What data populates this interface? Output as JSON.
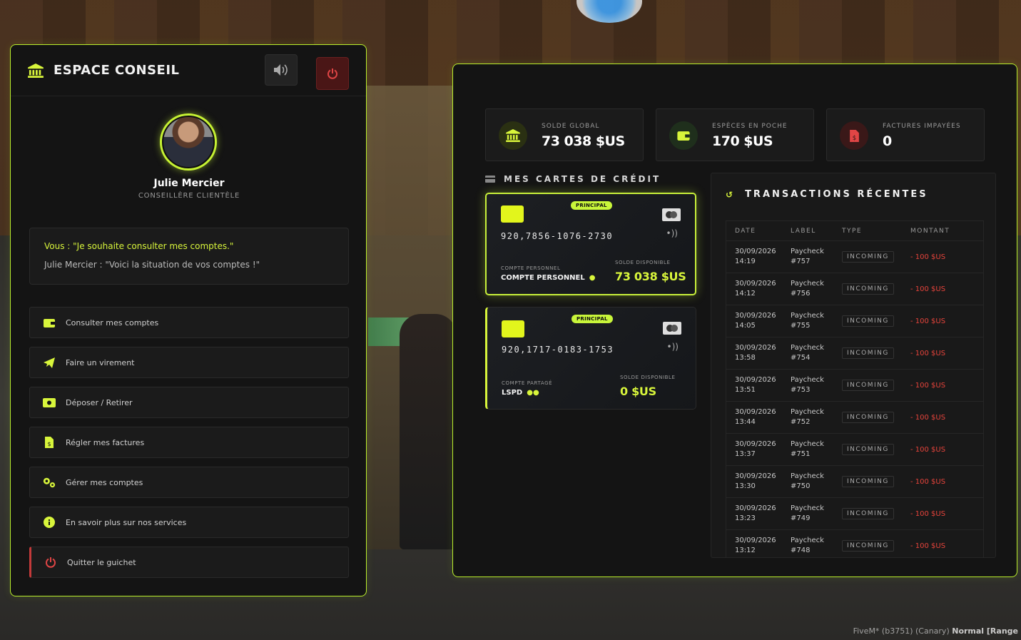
{
  "left": {
    "title": "ESPACE CONSEIL",
    "agent_name": "Julie Mercier",
    "agent_role": "CONSEILLÈRE CLIENTÈLE",
    "dialog_you": "Vous : \"Je souhaite consulter mes comptes.\"",
    "dialog_her": "Julie Mercier : \"Voici la situation de vos comptes !\"",
    "menu": [
      {
        "label": "Consulter mes comptes",
        "icon": "wallet-icon"
      },
      {
        "label": "Faire un virement",
        "icon": "paper-plane-icon"
      },
      {
        "label": "Déposer / Retirer",
        "icon": "money-icon"
      },
      {
        "label": "Régler mes factures",
        "icon": "invoice-icon"
      },
      {
        "label": "Gérer mes comptes",
        "icon": "gears-icon"
      },
      {
        "label": "En savoir plus sur nos services",
        "icon": "info-icon"
      },
      {
        "label": "Quitter le guichet",
        "icon": "power-icon"
      }
    ]
  },
  "stats": [
    {
      "label": "SOLDE GLOBAL",
      "value": "73 038 $US",
      "icon": "bank-icon",
      "color": "#d8f53b"
    },
    {
      "label": "ESPÈCES EN POCHE",
      "value": "170 $US",
      "icon": "wallet-icon",
      "color": "#d8f53b"
    },
    {
      "label": "FACTURES IMPAYÉES",
      "value": "0",
      "icon": "invoice-icon",
      "color": "#e04545"
    }
  ],
  "cards_title": "MES CARTES DE CRÉDIT",
  "cards": [
    {
      "badge": "PRINCIPAL",
      "number": "920,7856-1076-2730",
      "type_label": "COMPTE PERSONNEL",
      "owner": "COMPTE PERSONNEL",
      "balance_label": "SOLDE DISPONIBLE",
      "balance": "73 038 $US"
    },
    {
      "badge": "PRINCIPAL",
      "number": "920,1717-0183-1753",
      "type_label": "COMPTE PARTAGÉ",
      "owner": "LSPD",
      "balance_label": "SOLDE DISPONIBLE",
      "balance": "0 $US"
    }
  ],
  "transactions": {
    "title": "TRANSACTIONS RÉCENTES",
    "headers": [
      "DATE",
      "LABEL",
      "TYPE",
      "MONTANT"
    ],
    "rows": [
      {
        "date": "30/09/2026",
        "time": "14:19",
        "label": "Paycheck",
        "ref": "#757",
        "type": "INCOMING",
        "amount": "- 100 $US"
      },
      {
        "date": "30/09/2026",
        "time": "14:12",
        "label": "Paycheck",
        "ref": "#756",
        "type": "INCOMING",
        "amount": "- 100 $US"
      },
      {
        "date": "30/09/2026",
        "time": "14:05",
        "label": "Paycheck",
        "ref": "#755",
        "type": "INCOMING",
        "amount": "- 100 $US"
      },
      {
        "date": "30/09/2026",
        "time": "13:58",
        "label": "Paycheck",
        "ref": "#754",
        "type": "INCOMING",
        "amount": "- 100 $US"
      },
      {
        "date": "30/09/2026",
        "time": "13:51",
        "label": "Paycheck",
        "ref": "#753",
        "type": "INCOMING",
        "amount": "- 100 $US"
      },
      {
        "date": "30/09/2026",
        "time": "13:44",
        "label": "Paycheck",
        "ref": "#752",
        "type": "INCOMING",
        "amount": "- 100 $US"
      },
      {
        "date": "30/09/2026",
        "time": "13:37",
        "label": "Paycheck",
        "ref": "#751",
        "type": "INCOMING",
        "amount": "- 100 $US"
      },
      {
        "date": "30/09/2026",
        "time": "13:30",
        "label": "Paycheck",
        "ref": "#750",
        "type": "INCOMING",
        "amount": "- 100 $US"
      },
      {
        "date": "30/09/2026",
        "time": "13:23",
        "label": "Paycheck",
        "ref": "#749",
        "type": "INCOMING",
        "amount": "- 100 $US"
      },
      {
        "date": "30/09/2026",
        "time": "13:12",
        "label": "Paycheck",
        "ref": "#748",
        "type": "INCOMING",
        "amount": "- 100 $US"
      }
    ]
  },
  "footer": {
    "text": "FiveM* (b3751) (Canary)",
    "mode": "Normal [Range"
  }
}
